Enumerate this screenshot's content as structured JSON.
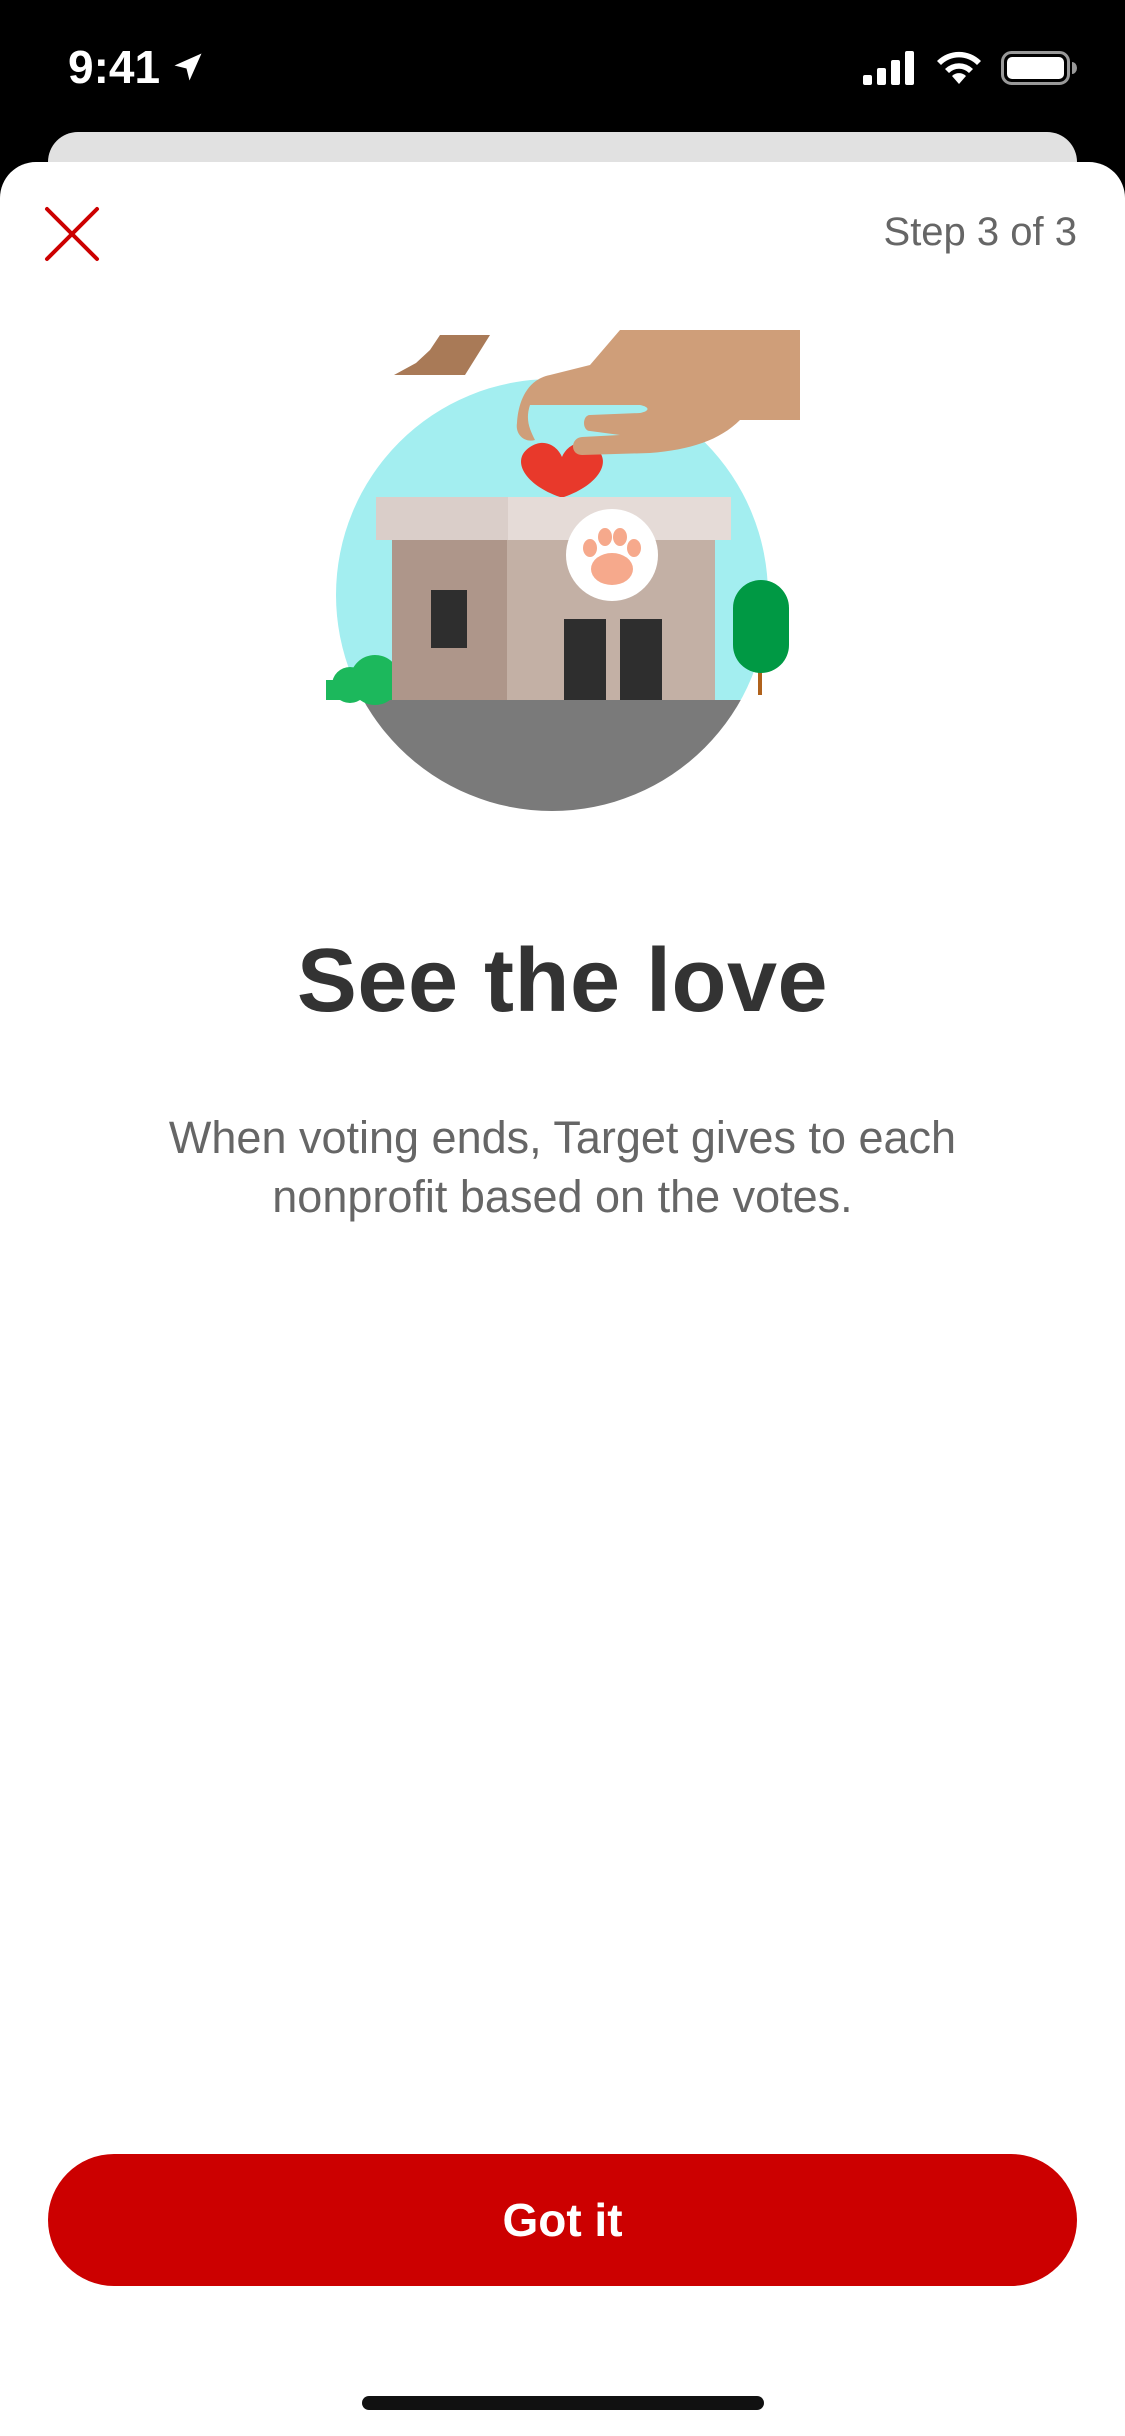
{
  "status_bar": {
    "time": "9:41",
    "icons": [
      "location-arrow-icon",
      "cellular-signal-icon",
      "wifi-icon",
      "battery-icon"
    ]
  },
  "header": {
    "close_icon": "close-icon",
    "step_label": "Step 3 of 3"
  },
  "illustration": {
    "name": "donation-hand-heart-building-illustration"
  },
  "content": {
    "title": "See the love",
    "description": "When voting ends, Target gives to each nonprofit based on the votes."
  },
  "footer": {
    "button_label": "Got it"
  },
  "colors": {
    "accent": "#cc0000",
    "title_text": "#333333",
    "body_text": "#666666"
  }
}
